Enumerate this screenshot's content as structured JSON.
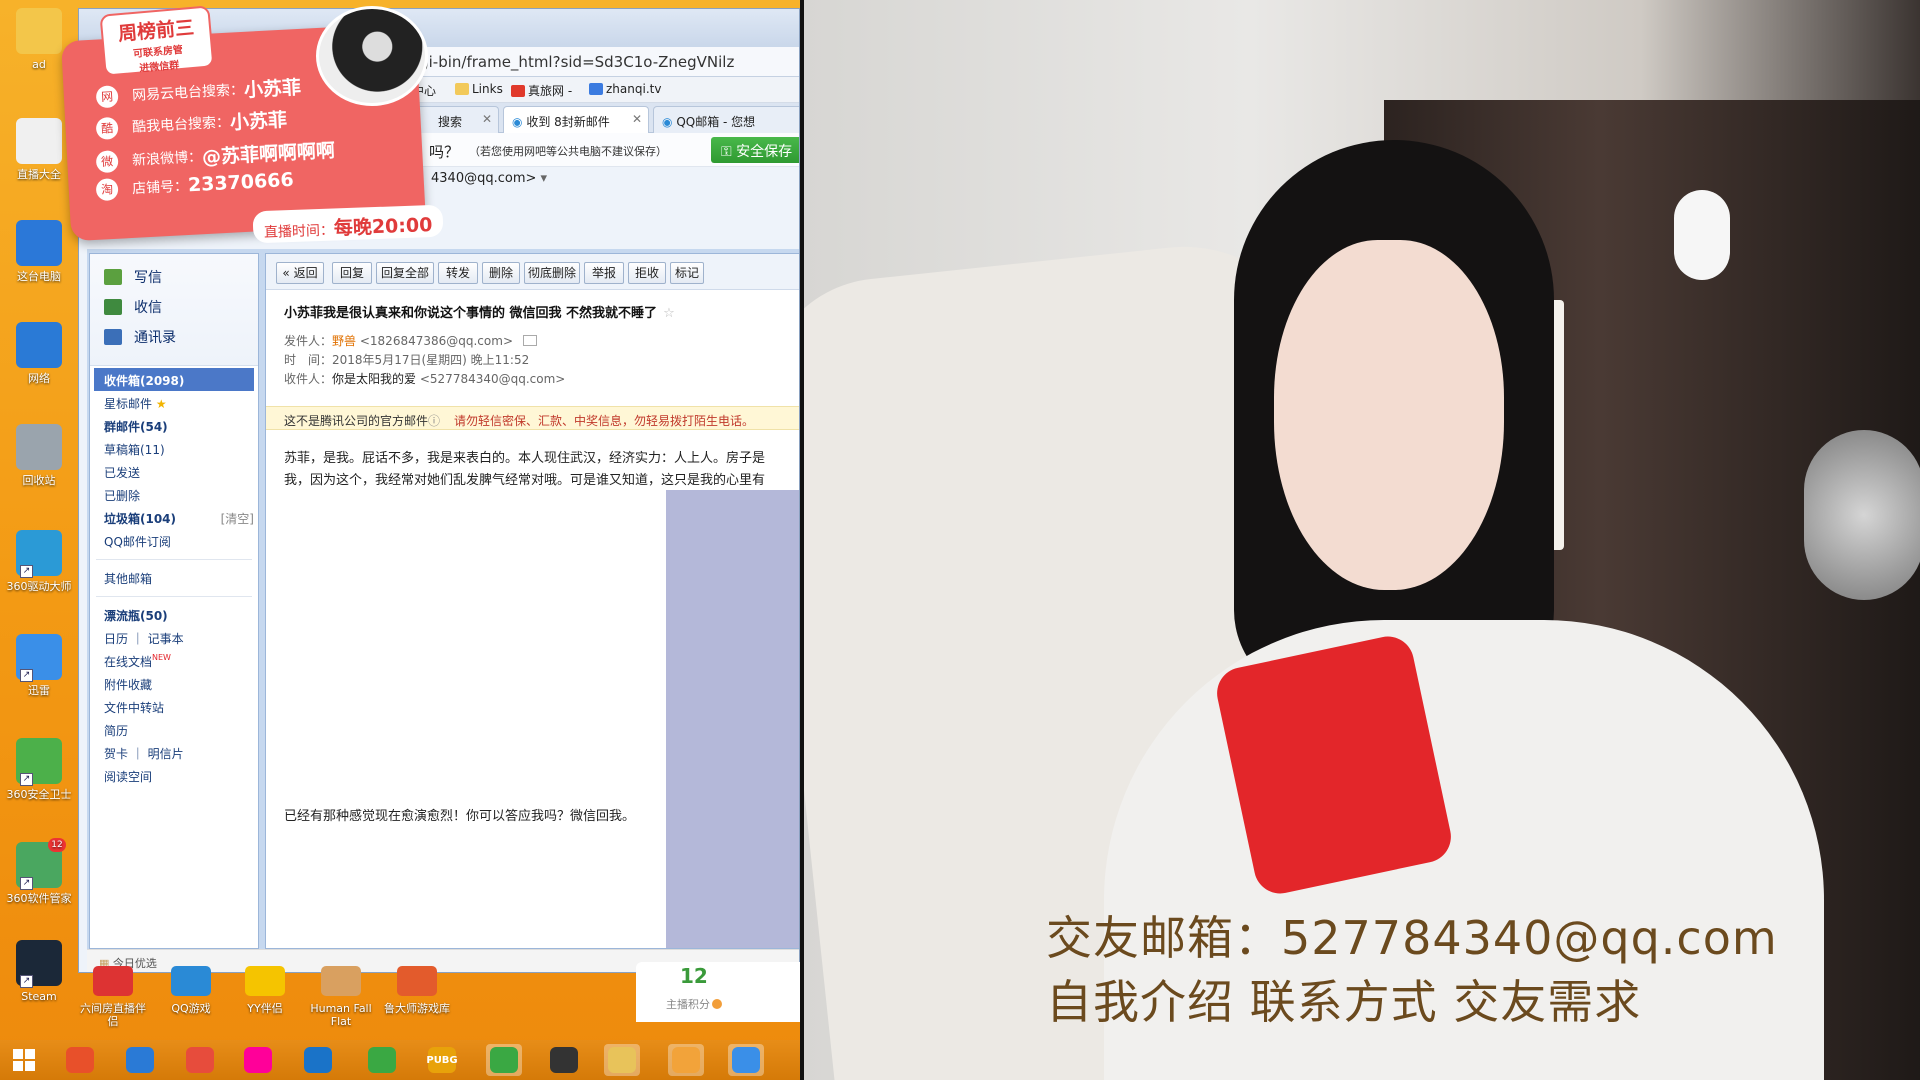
{
  "desktop": {
    "icons": [
      {
        "label": "ad",
        "name": "user-folder-icon",
        "color": "#f3c64a"
      },
      {
        "label": "直播大全",
        "name": "document-icon",
        "color": "#f0f0f0"
      },
      {
        "label": "这台电脑",
        "name": "computer-icon",
        "color": "#2b78d8"
      },
      {
        "label": "网络",
        "name": "network-icon",
        "color": "#2a7ad6"
      },
      {
        "label": "回收站",
        "name": "recycle-bin-icon",
        "color": "#9aa4ad"
      },
      {
        "label": "360驱动大师",
        "name": "driver-master-icon",
        "color": "#2b9ad6"
      },
      {
        "label": "迅雷",
        "name": "thunder-icon",
        "color": "#3a8fe8"
      },
      {
        "label": "360安全卫士",
        "name": "security-guard-icon",
        "color": "#4cb04a"
      },
      {
        "label": "360软件管家",
        "name": "software-manager-icon",
        "color": "#4aa760",
        "badge": "12"
      },
      {
        "label": "Steam",
        "name": "steam-icon",
        "color": "#1b2838"
      }
    ],
    "bottom_icons": [
      {
        "label": "六间房直播伴侣",
        "name": "liujianfang-icon",
        "color": "#d33"
      },
      {
        "label": "QQ游戏",
        "name": "qq-game-icon",
        "color": "#2a8ad6"
      },
      {
        "label": "YY伴侣",
        "name": "yy-icon",
        "color": "#f5c400"
      },
      {
        "label": "Human Fall Flat",
        "name": "human-fall-flat-icon",
        "color": "#d9a060"
      },
      {
        "label": "鲁大师游戏库",
        "name": "ludashi-icon",
        "color": "#e35b2c"
      }
    ]
  },
  "browser": {
    "url": ".com/cgi-bin/frame_html?sid=Sd3C1o-ZnegVNilz",
    "favorites": [
      "游戏中心",
      "Links",
      "真旅网 -",
      "zhanqi.tv"
    ],
    "tabs": [
      {
        "label": "搜索",
        "active": false
      },
      {
        "label": "收到 8封新邮件",
        "active": true
      },
      {
        "label": "QQ邮箱 - 您想",
        "active": false
      }
    ],
    "notice_question": "吗？",
    "notice_hint": "（若您使用网吧等公共电脑不建议保存）",
    "safe_button": "安全保存",
    "account": "4340@qq.com>",
    "bottom_bar": "今日优选"
  },
  "mail": {
    "nav_top": [
      {
        "label": "写信",
        "name": "compose",
        "color": "#5ba03f"
      },
      {
        "label": "收信",
        "name": "receive",
        "color": "#3f8a3f"
      },
      {
        "label": "通讯录",
        "name": "contacts",
        "color": "#3b6fb8"
      }
    ],
    "folders": [
      {
        "label": "收件箱(2098)",
        "style": "sel"
      },
      {
        "label": "星标邮件",
        "star": true
      },
      {
        "label": "群邮件(54)",
        "style": "bold"
      },
      {
        "label": "草稿箱(11)"
      },
      {
        "label": "已发送"
      },
      {
        "label": "已删除"
      },
      {
        "label": "垃圾箱(104)",
        "style": "bold",
        "extra": "[清空]"
      },
      {
        "label": "QQ邮件订阅"
      }
    ],
    "folders2": [
      {
        "label": "其他邮箱"
      }
    ],
    "folders3": [
      {
        "label": "漂流瓶(50)",
        "style": "bold"
      },
      {
        "label": "日历 ｜ 记事本"
      },
      {
        "label": "在线文档",
        "new": "NEW"
      },
      {
        "label": "附件收藏"
      },
      {
        "label": "文件中转站"
      },
      {
        "label": "简历"
      },
      {
        "label": "贺卡 ｜ 明信片"
      },
      {
        "label": "阅读空间"
      }
    ],
    "toolbar": [
      "« 返回",
      "回复",
      "回复全部",
      "转发",
      "删除",
      "彻底删除",
      "举报",
      "拒收",
      "标记"
    ],
    "subject": "小苏菲我是很认真来和你说这个事情的 微信回我 不然我就不睡了",
    "sender_label": "发件人：",
    "sender_name": "野兽",
    "sender_email": "<1826847386@qq.com>",
    "time_label": "时　间：",
    "time_value": "2018年5月17日(星期四) 晚上11:52",
    "recipient_label": "收件人：",
    "recipient_name": "你是太阳我的爱",
    "recipient_email": "<527784340@qq.com>",
    "warning_left": "这不是腾讯公司的官方邮件",
    "warning_right": "请勿轻信密保、汇款、中奖信息，勿轻易拨打陌生电话。",
    "body_line1": "苏菲，是我。屁话不多，我是来表白的。本人现住武汉，经济实力：人上人。房子是",
    "body_line2": "我，因为这个，我经常对她们乱发脾气经常对哦。可是谁又知道，这只是我的心里有",
    "body_line3": "已经有那种感觉现在愈演愈烈！你可以答应我吗？微信回我。"
  },
  "promo": {
    "rank_line1": "周榜前三",
    "rank_line2": "可联系房管",
    "rank_line3": "进微信群",
    "rows": [
      {
        "icon": "网",
        "label": "网易云电台搜索：",
        "value": "小苏菲"
      },
      {
        "icon": "酷",
        "label": "酷我电台搜索：",
        "value": "小苏菲"
      },
      {
        "icon": "微",
        "label": "新浪微博：",
        "value": "@苏菲啊啊啊啊"
      },
      {
        "icon": "淘",
        "label": "店铺号：",
        "value": "23370666"
      }
    ],
    "live_label": "直播时间：",
    "live_value": "每晚20:00"
  },
  "points": {
    "value": "12",
    "label": "主播积分"
  },
  "stream": {
    "line1": "交友邮箱：527784340@qq.com",
    "line2": "自我介绍 联系方式 交友需求"
  },
  "taskbar": {
    "items": [
      {
        "name": "start-button",
        "label": ""
      },
      {
        "name": "browser-taskbar-icon",
        "label": "",
        "color": "#e8502a"
      },
      {
        "name": "network-taskbar-icon",
        "label": "",
        "color": "#2a7ad6"
      },
      {
        "name": "chrome-taskbar-icon",
        "label": "",
        "color": "#e74c3c"
      },
      {
        "name": "photos-taskbar-icon",
        "label": "",
        "color": "#f09"
      },
      {
        "name": "camera-taskbar-icon",
        "label": "",
        "color": "#1a73c8"
      },
      {
        "name": "360-browser-taskbar-icon",
        "label": "",
        "color": "#3aa843"
      },
      {
        "name": "pubg-taskbar-icon",
        "label": "PUBG",
        "color": "#e8a20a"
      },
      {
        "name": "update-taskbar-icon",
        "label": "",
        "color": "#3aa843",
        "active": true
      },
      {
        "name": "obs-taskbar-icon",
        "label": "",
        "color": "#333"
      },
      {
        "name": "explorer-taskbar-icon",
        "label": "",
        "color": "#e8c35a",
        "active": true
      },
      {
        "name": "chat-taskbar-icon",
        "label": "",
        "color": "#f2a33a",
        "active": true
      },
      {
        "name": "thunder-taskbar-icon",
        "label": "",
        "color": "#3a8fe8",
        "active": true
      }
    ]
  }
}
